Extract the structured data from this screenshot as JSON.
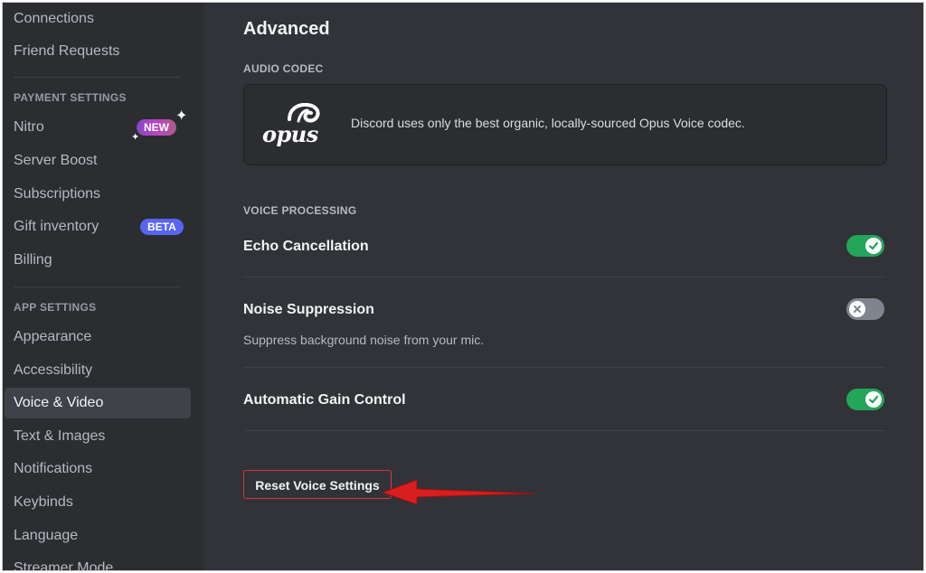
{
  "sidebar": {
    "top_items": [
      "Connections",
      "Friend Requests"
    ],
    "payment_header": "PAYMENT SETTINGS",
    "payment_items": [
      {
        "label": "Nitro",
        "badge": "NEW"
      },
      {
        "label": "Server Boost"
      },
      {
        "label": "Subscriptions"
      },
      {
        "label": "Gift inventory",
        "badge": "BETA"
      },
      {
        "label": "Billing"
      }
    ],
    "app_header": "APP SETTINGS",
    "app_items": [
      "Appearance",
      "Accessibility",
      "Voice & Video",
      "Text & Images",
      "Notifications",
      "Keybinds",
      "Language",
      "Streamer Mode"
    ],
    "active_item": "Voice & Video"
  },
  "main": {
    "title": "Advanced",
    "audio_codec": {
      "label": "AUDIO CODEC",
      "logo_text": "opus",
      "description": "Discord uses only the best organic, locally-sourced Opus Voice codec."
    },
    "voice_processing": {
      "label": "VOICE PROCESSING",
      "echo_cancellation": {
        "label": "Echo Cancellation",
        "enabled": true
      },
      "noise_suppression": {
        "label": "Noise Suppression",
        "description": "Suppress background noise from your mic.",
        "enabled": false
      },
      "automatic_gain_control": {
        "label": "Automatic Gain Control",
        "enabled": true
      }
    },
    "reset_button": "Reset Voice Settings"
  },
  "colors": {
    "toggle_on": "#23a55a",
    "toggle_off": "#80848e",
    "reset_border": "#da373c",
    "annotation_arrow": "#d81e1e"
  }
}
